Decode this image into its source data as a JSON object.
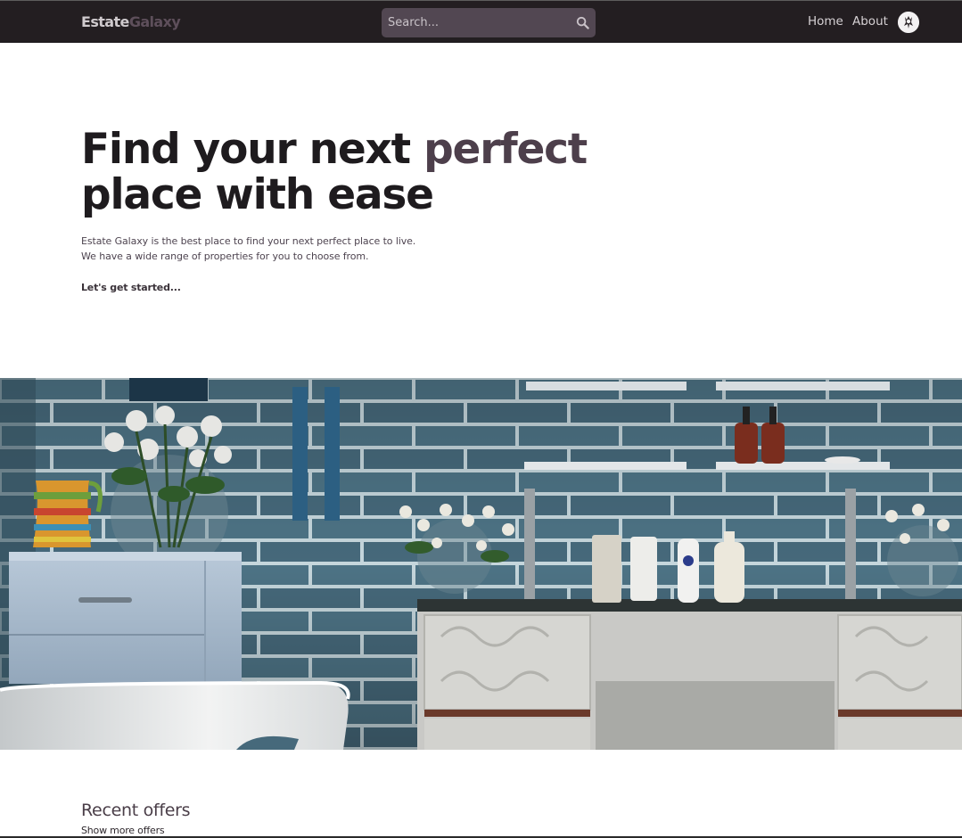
{
  "header": {
    "logo_part1": "Estate",
    "logo_part2": "Galaxy",
    "search_placeholder": "Search...",
    "nav_home": "Home",
    "nav_about": "About",
    "search_icon": "search-icon",
    "avatar_icon": "user-avatar-icon"
  },
  "hero": {
    "title_part1": "Find your next ",
    "title_accent": "perfect",
    "title_part2": "place with ease",
    "text_line1": "Estate Galaxy is the best place to find your next perfect place to live.",
    "text_line2": "We have a wide range of properties for you to choose from.",
    "cta": "Let's get started..."
  },
  "offers": {
    "title": "Recent offers",
    "show_more": "Show more offers"
  },
  "colors": {
    "header_bg": "#231e21",
    "accent": "#4d3f4b",
    "search_bg": "#524752",
    "tile_blue": "#4f7487"
  }
}
